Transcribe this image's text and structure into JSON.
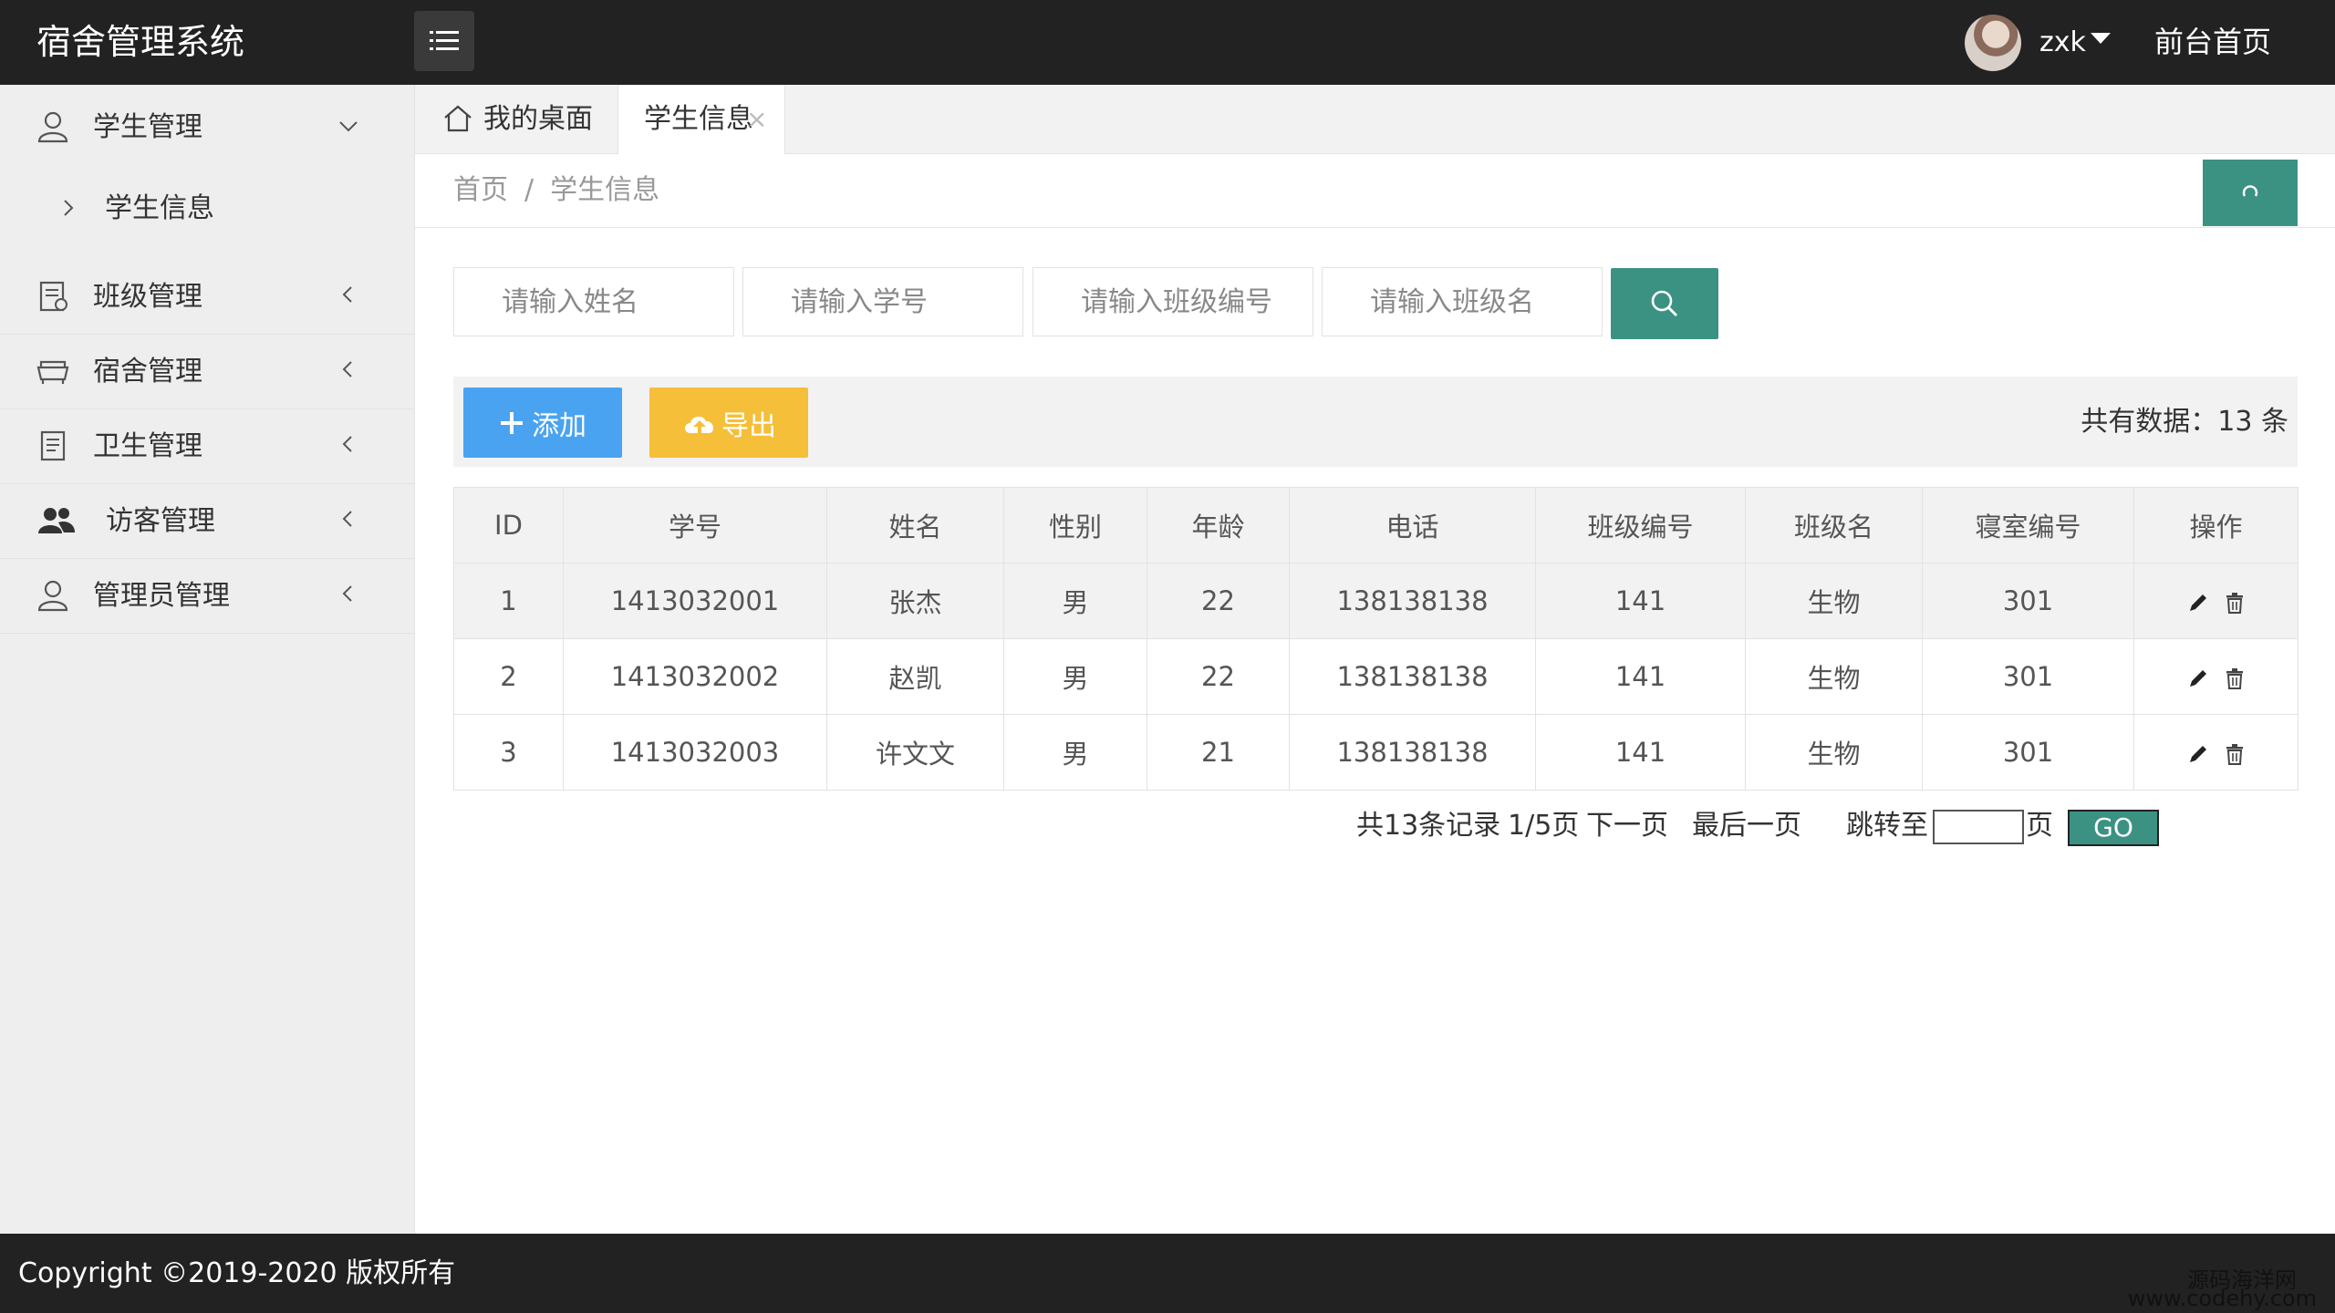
{
  "header": {
    "app_title": "宿舍管理系统",
    "username": "zxk",
    "front_link": "前台首页"
  },
  "sidebar": {
    "items": [
      {
        "label": "学生管理",
        "icon": "user-icon",
        "expanded": true,
        "sub": [
          {
            "label": "学生信息"
          }
        ]
      },
      {
        "label": "班级管理",
        "icon": "document-icon"
      },
      {
        "label": "宿舍管理",
        "icon": "sofa-icon"
      },
      {
        "label": "卫生管理",
        "icon": "notepad-icon"
      },
      {
        "label": "访客管理",
        "icon": "group-icon"
      },
      {
        "label": "管理员管理",
        "icon": "admin-user-icon"
      }
    ]
  },
  "tabs": {
    "home": "我的桌面",
    "active": "学生信息",
    "close": "×"
  },
  "breadcrumb": {
    "home": "首页",
    "sep": "/",
    "current": "学生信息"
  },
  "search": {
    "name_placeholder": "请输入姓名",
    "id_placeholder": "请输入学号",
    "class_no_placeholder": "请输入班级编号",
    "class_name_placeholder": "请输入班级名"
  },
  "toolbar": {
    "add_label": "添加",
    "export_label": "导出",
    "total_text": "共有数据：13 条"
  },
  "table": {
    "headers": [
      "ID",
      "学号",
      "姓名",
      "性别",
      "年龄",
      "电话",
      "班级编号",
      "班级名",
      "寝室编号",
      "操作"
    ],
    "rows": [
      [
        "1",
        "1413032001",
        "张杰",
        "男",
        "22",
        "138138138",
        "141",
        "生物",
        "301"
      ],
      [
        "2",
        "1413032002",
        "赵凯",
        "男",
        "22",
        "138138138",
        "141",
        "生物",
        "301"
      ],
      [
        "3",
        "1413032003",
        "许文文",
        "男",
        "21",
        "138138138",
        "141",
        "生物",
        "301"
      ]
    ]
  },
  "pagination": {
    "total_records": "共13条记录",
    "page_info": "1/5页",
    "next": "下一页",
    "last": "最后一页",
    "jump_to": "跳转至",
    "page_unit": "页",
    "go": "GO"
  },
  "footer": {
    "copyright": "Copyright ©2019-2020 版权所有",
    "watermark_line1": "源码海洋网",
    "watermark_line2": "www.codehy.com"
  },
  "colors": {
    "header_bg": "#222222",
    "accent_teal": "#3b9283",
    "add_blue": "#4aa3f0",
    "export_yellow": "#f5bf3a",
    "sidebar_bg": "#eeeeee"
  }
}
